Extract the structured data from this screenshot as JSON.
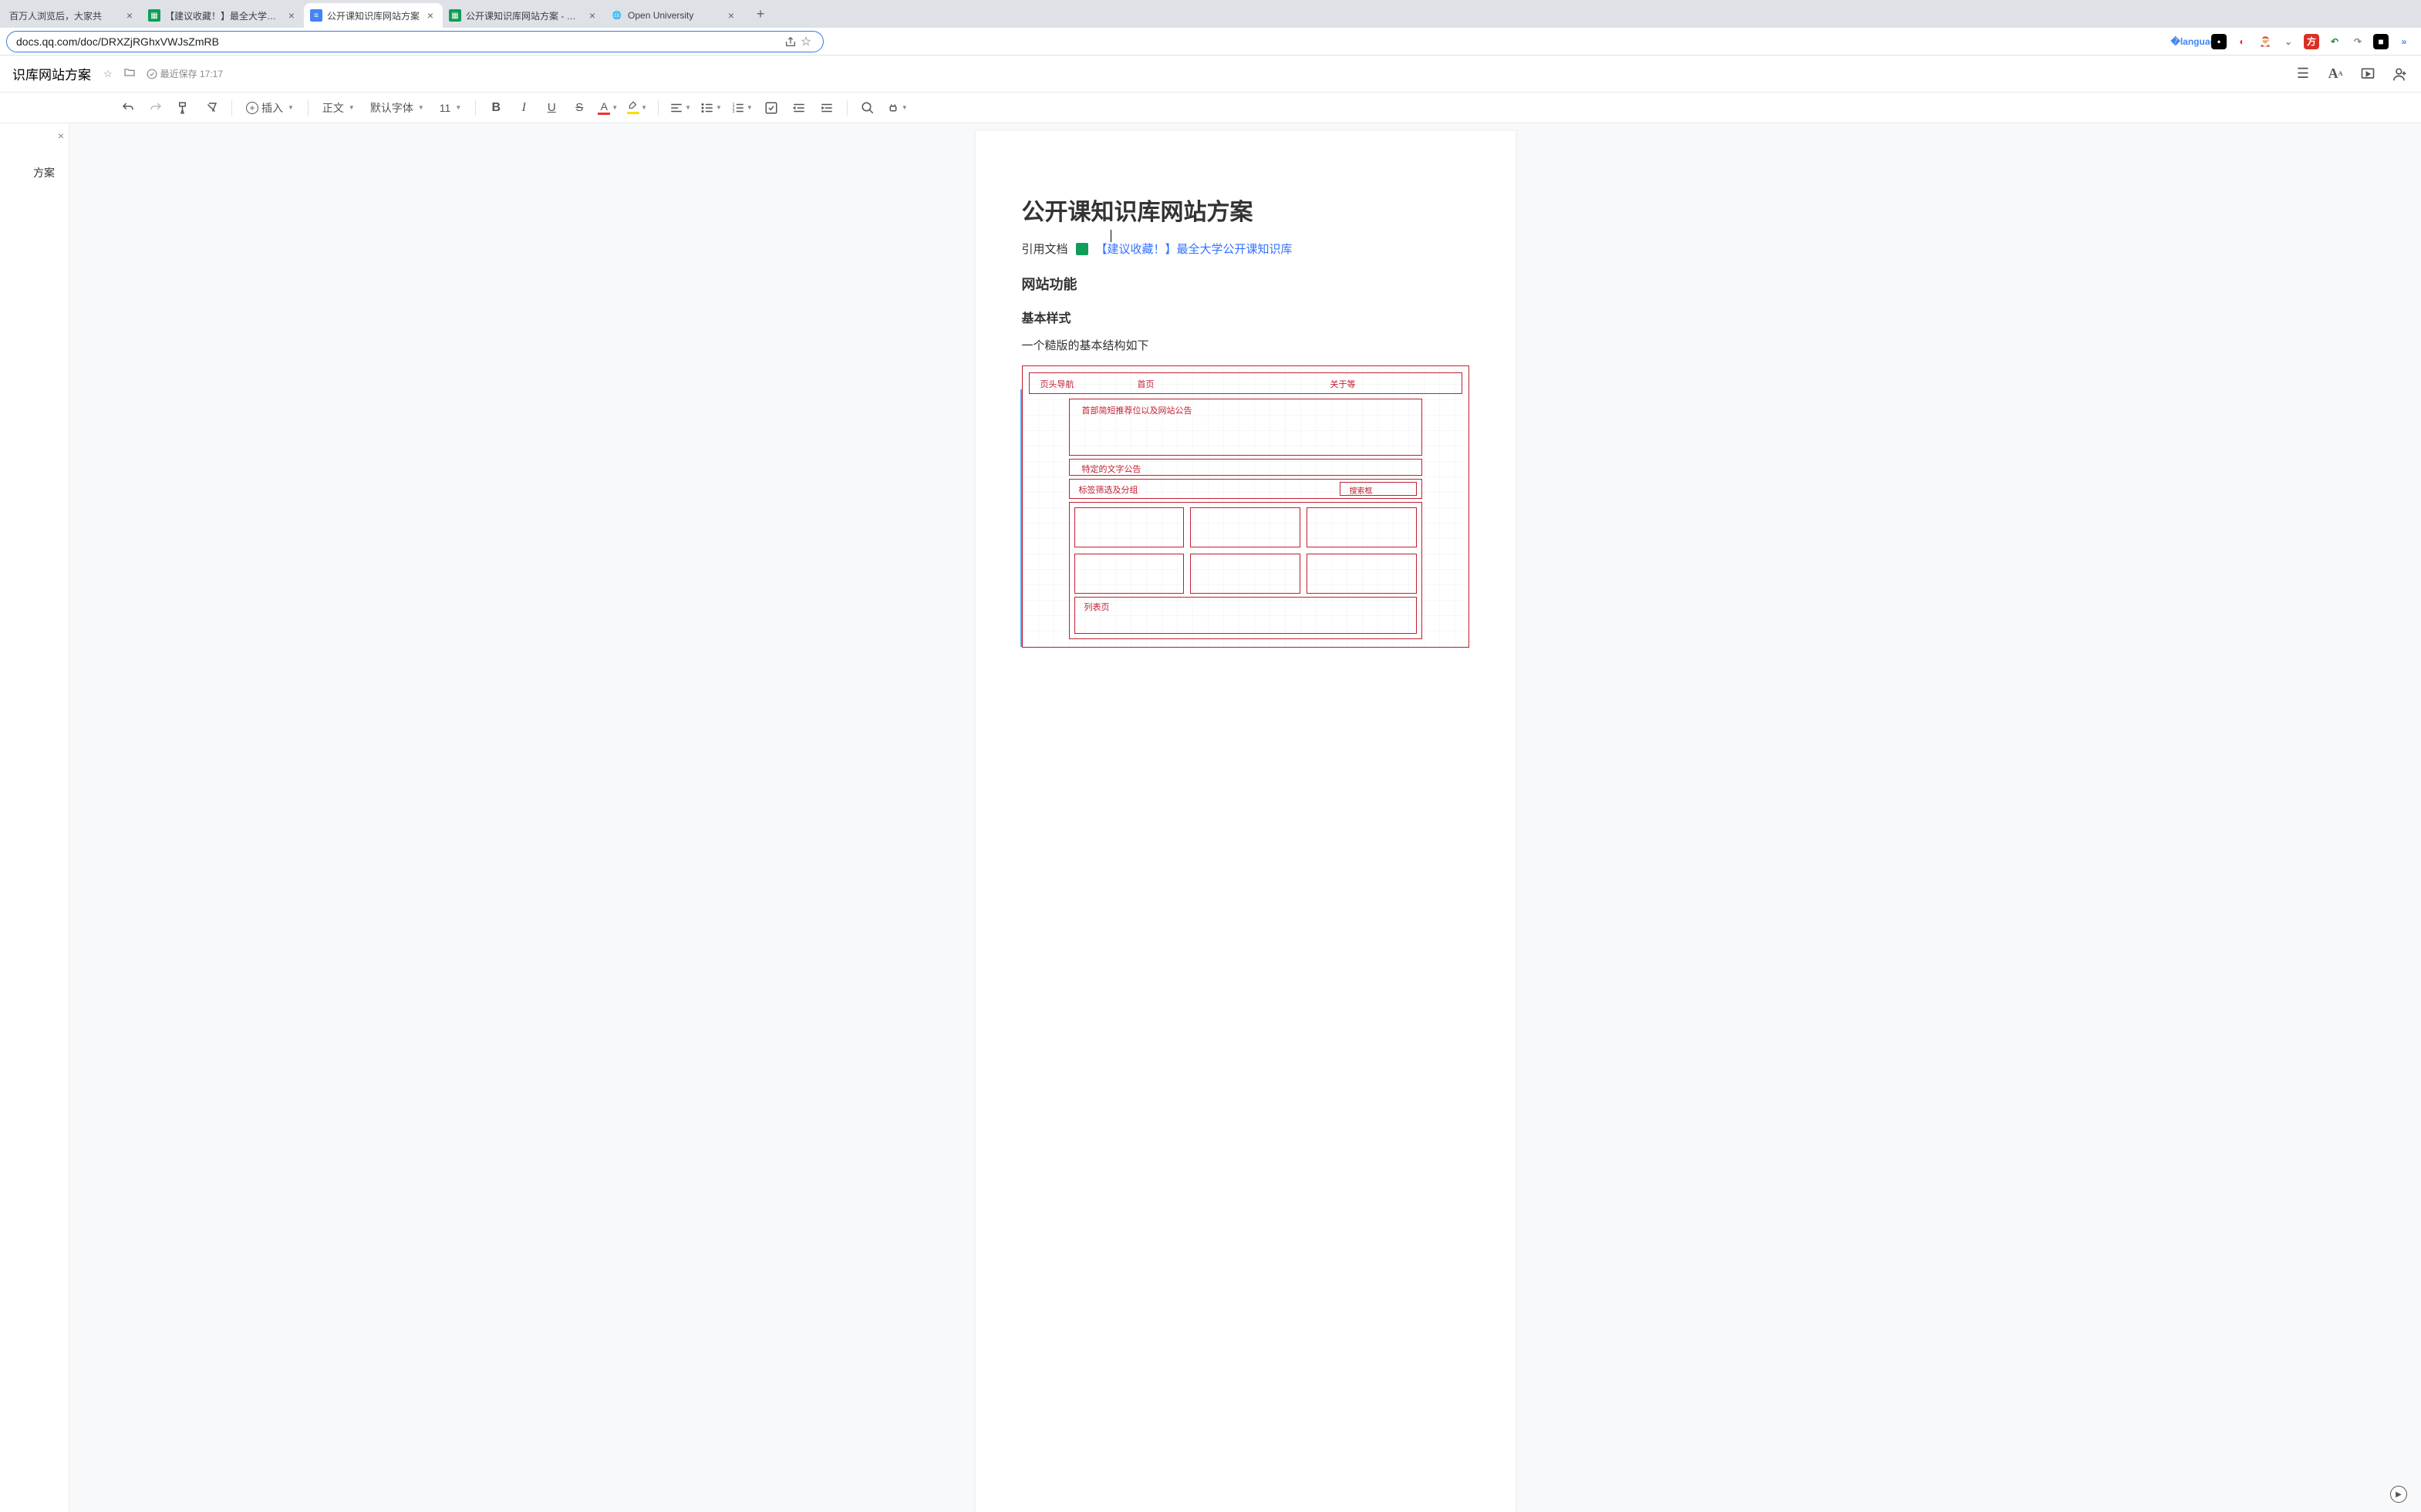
{
  "browser": {
    "tabs": [
      {
        "title": "百万人浏览后，大家共",
        "favicon": "none"
      },
      {
        "title": "【建议收藏！】最全大学公开课",
        "favicon": "sheets"
      },
      {
        "title": "公开课知识库网站方案",
        "favicon": "doc",
        "active": true
      },
      {
        "title": "公开课知识库网站方案 - 任务拆",
        "favicon": "sheets"
      },
      {
        "title": "Open University",
        "favicon": "globe"
      }
    ],
    "url": "docs.qq.com/doc/DRXZjRGhxVWJsZmRB"
  },
  "doc": {
    "title_partial": "识库网站方案",
    "save_status": "最近保存 17:17",
    "toolbar": {
      "insert": "插入",
      "paragraph": "正文",
      "font_family": "默认字体",
      "font_size": "11"
    }
  },
  "outline": {
    "item1": "方案"
  },
  "content": {
    "h1": "公开课知识库网站方案",
    "ref_label": "引用文档",
    "ref_link": "【建议收藏！】最全大学公开课知识库",
    "h2": "网站功能",
    "h3": "基本样式",
    "body": "一个糙版的基本结构如下",
    "wireframe": {
      "nav_l": "页头导航",
      "nav_c": "首页",
      "nav_r": "关于等",
      "hero": "首部简短推荐位以及网站公告",
      "notice": "特定的文字公告",
      "filter": "标签筛选及分组",
      "search": "搜索框",
      "list": "列表页"
    }
  }
}
